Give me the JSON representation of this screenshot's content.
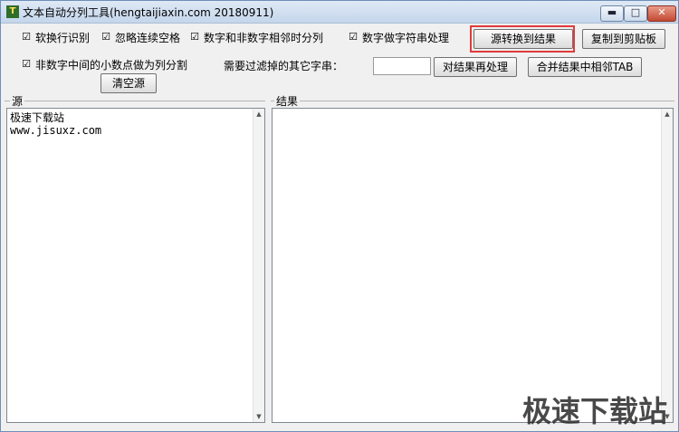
{
  "window": {
    "title": "文本自动分列工具(hengtaijiaxin.com 20180911)",
    "app_icon_glyph": "T",
    "minimize_glyph": "▬",
    "maximize_glyph": "□",
    "close_glyph": "✕"
  },
  "options": {
    "checked_glyph": "☑",
    "soft_wrap": "软换行识别",
    "ignore_spaces": "忽略连续空格",
    "split_digit_nondigit": "数字和非数字相邻时分列",
    "digit_as_string": "数字做字符串处理",
    "decimal_split": "非数字中间的小数点做为列分割"
  },
  "filter": {
    "label": "需要过滤掉的其它字串：",
    "value": ""
  },
  "buttons": {
    "convert": "源转换到结果",
    "copy_clipboard": "复制到剪贴板",
    "reprocess": "对结果再处理",
    "merge_tab": "合并结果中相邻TAB",
    "clear_source": "清空源"
  },
  "source": {
    "label": "源",
    "text": "极速下载站\nwww.jisuxz.com"
  },
  "result": {
    "label": "结果",
    "text": ""
  },
  "watermark": "极速下载站"
}
